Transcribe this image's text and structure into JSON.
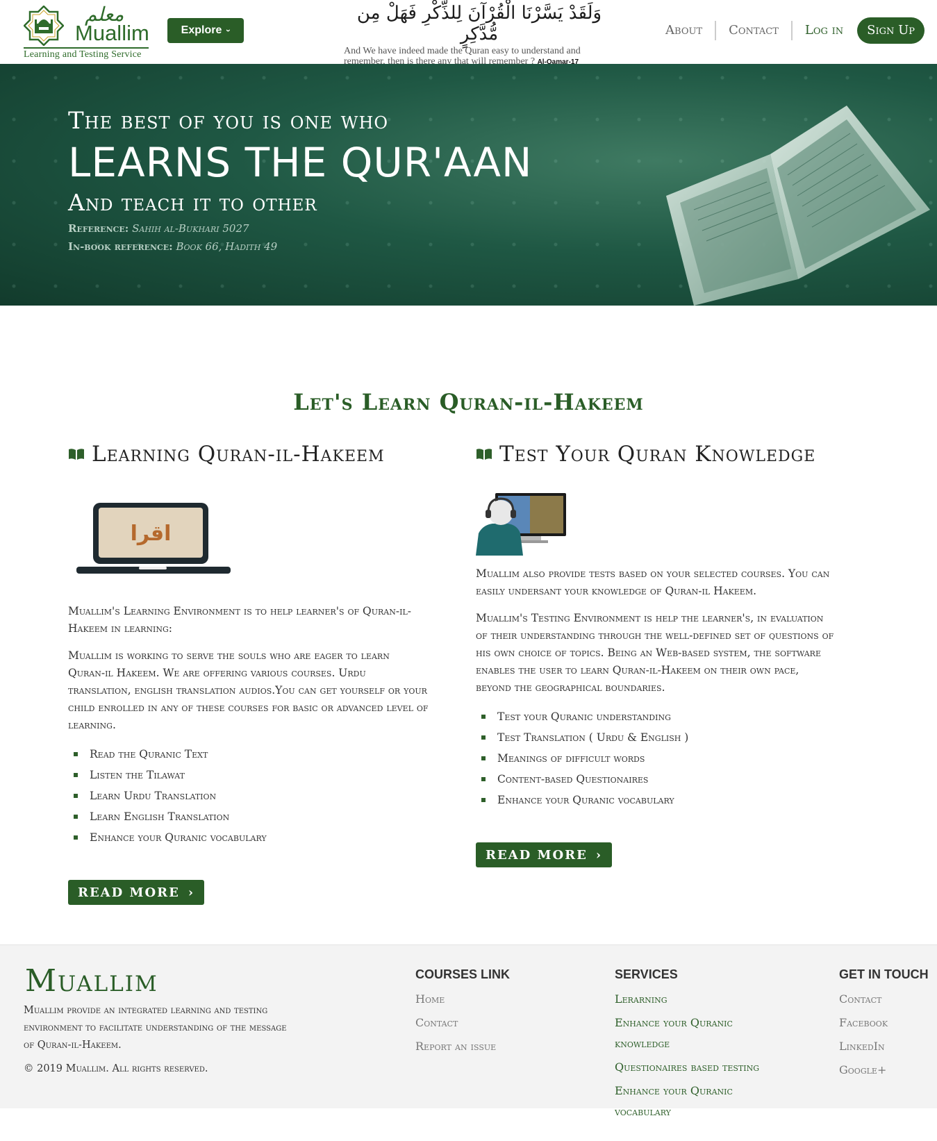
{
  "header": {
    "logo_arabic": "معلم",
    "logo_name": "Muallim",
    "logo_tagline": "Learning and Testing Service",
    "explore_label": "Explore",
    "verse_arabic": "وَلَقَدْ يَسَّرْنَا الْقُرْآنَ لِلذِّكْرِ فَهَلْ مِن مُّدَّكِرٍ",
    "verse_english": "And We have indeed made the Quran easy to understand and remember, then is there any that will remember ?",
    "verse_ref": "Al-Qamar-17",
    "nav": {
      "about": "About",
      "contact": "Contact",
      "login": "Log in",
      "signup": "Sign Up"
    }
  },
  "hero": {
    "line1": "The best of you is one who",
    "line2": "LEARNS THE QUR'AAN",
    "line3": "And teach it to other",
    "ref_label": "Reference:",
    "ref_value": "Sahih al-Bukhari 5027",
    "inbook_label": "In-book reference:",
    "inbook_value": "Book 66, Hadith 49"
  },
  "main": {
    "title": "Let's Learn Quran-il-Hakeem",
    "learning": {
      "heading": "Learning Quran-il-Hakeem",
      "image_text": "اقرا",
      "p1": "Muallim's Learning Environment is to help learner's of Quran-il-Hakeem in learning:",
      "p2": "Muallim is working to serve the souls who are eager to learn Quran-il Hakeem. We are offering various courses. Urdu translation, english translation audios.You can get yourself or your child enrolled in any of these courses for basic or advanced level of learning.",
      "items": [
        "Read the Quranic Text",
        "Listen the Tilawat",
        "Learn Urdu Translation",
        "Learn English Translation",
        "Enhance your Quranic vocabulary"
      ],
      "read_more": "READ MORE"
    },
    "testing": {
      "heading": "Test Your Quran Knowledge",
      "p1": "Muallim also provide tests based on your selected courses. You can easily undersant your knowledge of Quran-il Hakeem.",
      "p2": "Muallim's Testing Environment is help the learner's, in evaluation of their understanding through the well-defined set of questions of his own choice of topics. Being an Web-based system, the software enables the user to learn Quran-il-Hakeem on their own pace, beyond the geographical boundaries.",
      "items": [
        "Test your Quranic understanding",
        "Test Translation ( Urdu & English )",
        "Meanings of difficult words",
        "Content-based Questionaires",
        "Enhance your Quranic vocabulary"
      ],
      "read_more": "READ MORE"
    }
  },
  "footer": {
    "brand": "Muallim",
    "desc": "Muallim provide an integrated learning and testing environment to facilitate understanding of the message of Quran-il-Hakeem.",
    "copyright": "© 2019 Muallim. All rights reserved.",
    "courses": {
      "title": "COURSES LINK",
      "links": [
        "Home",
        "Contact",
        "Report an issue"
      ]
    },
    "services": {
      "title": "SERVICES",
      "links": [
        "Lerarning",
        "Enhance your Quranic knowledge",
        "Questionaires based testing",
        "Enhance your Quranic vocabulary"
      ]
    },
    "touch": {
      "title": "GET IN TOUCH",
      "links": [
        "Contact",
        "Facebook",
        "LinkedIn",
        "Google+"
      ]
    }
  },
  "colors": {
    "brand_green": "#2a5d27",
    "hero_green": "#1f5844"
  }
}
